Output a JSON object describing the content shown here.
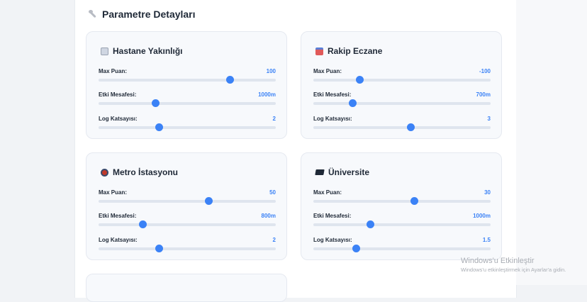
{
  "section": {
    "title": "Parametre Detayları",
    "icon": "wrench-icon"
  },
  "labels": {
    "max": "Max Puan:",
    "mesafe": "Etki Mesafesi:",
    "log": "Log Katsayısı:"
  },
  "cards": [
    {
      "title": "Hastane Yakınlığı",
      "icon": "hospital-icon",
      "max": {
        "value": "100",
        "level": 0.74
      },
      "mesafe": {
        "value": "1000m",
        "level": 0.32
      },
      "log": {
        "value": "2",
        "level": 0.34
      }
    },
    {
      "title": "Rakip Eczane",
      "icon": "store-icon",
      "max": {
        "value": "-100",
        "level": 0.26
      },
      "mesafe": {
        "value": "700m",
        "level": 0.22
      },
      "log": {
        "value": "3",
        "level": 0.55
      }
    },
    {
      "title": "Metro İstasyonu",
      "icon": "metro-icon",
      "max": {
        "value": "50",
        "level": 0.62
      },
      "mesafe": {
        "value": "800m",
        "level": 0.25
      },
      "log": {
        "value": "2",
        "level": 0.34
      }
    },
    {
      "title": "Üniversite",
      "icon": "graduation-cap-icon",
      "max": {
        "value": "30",
        "level": 0.57
      },
      "mesafe": {
        "value": "1000m",
        "level": 0.32
      },
      "log": {
        "value": "1.5",
        "level": 0.24
      }
    }
  ],
  "watermark": {
    "title": "Windows'u Etkinleştir",
    "subtitle": "Windows'u etkinleştirmek için Ayarlar'a gidin."
  }
}
